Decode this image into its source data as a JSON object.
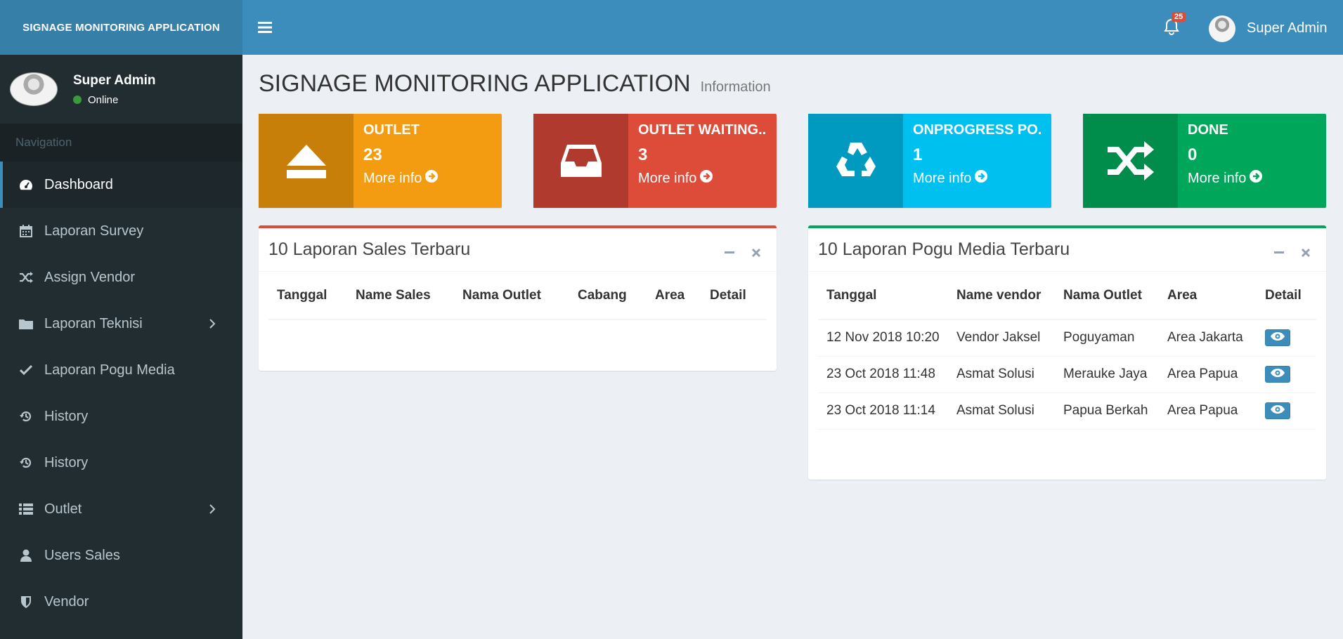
{
  "app": {
    "logo_text": "SIGNAGE MONITORING APPLICATION"
  },
  "sidebar": {
    "user_name": "Super Admin",
    "status": "Online",
    "nav_header": "Navigation",
    "items": [
      {
        "label": "Dashboard",
        "icon": "dashboard-icon",
        "active": true
      },
      {
        "label": "Laporan Survey",
        "icon": "calendar-icon"
      },
      {
        "label": "Assign Vendor",
        "icon": "shuffle-icon"
      },
      {
        "label": "Laporan Teknisi",
        "icon": "folder-icon",
        "has_children": true
      },
      {
        "label": "Laporan Pogu Media",
        "icon": "check-icon"
      },
      {
        "label": "History",
        "icon": "history-icon"
      },
      {
        "label": "History",
        "icon": "history-icon"
      },
      {
        "label": "Outlet",
        "icon": "list-icon",
        "has_children": true
      },
      {
        "label": "Users Sales",
        "icon": "user-icon"
      },
      {
        "label": "Vendor",
        "icon": "shield-icon"
      }
    ]
  },
  "header": {
    "notification_count": "25",
    "user_name": "Super Admin"
  },
  "page": {
    "title": "SIGNAGE MONITORING APPLICATION",
    "subtitle": "Information"
  },
  "info_boxes": [
    {
      "title": "OUTLET",
      "value": "23",
      "more": "More info",
      "icon": "eject-icon",
      "color": "#f39c12",
      "icon_bg": "#c87f0a"
    },
    {
      "title": "OUTLET WAITING...",
      "value": "3",
      "more": "More info",
      "icon": "inbox-icon",
      "color": "#dd4b39",
      "icon_bg": "#b03a2e"
    },
    {
      "title": "ONPROGRESS PO...",
      "value": "1",
      "more": "More info",
      "icon": "recycle-icon",
      "color": "#00c0ef",
      "icon_bg": "#009ac0"
    },
    {
      "title": "DONE",
      "value": "0",
      "more": "More info",
      "icon": "shuffle-icon",
      "color": "#00a65a",
      "icon_bg": "#008d4c"
    }
  ],
  "sales_box": {
    "title": "10 Laporan Sales Terbaru",
    "accent": "#dd4b39",
    "columns": [
      "Tanggal",
      "Name Sales",
      "Nama Outlet",
      "Cabang",
      "Area",
      "Detail"
    ]
  },
  "media_box": {
    "title": "10 Laporan Pogu Media Terbaru",
    "accent": "#00a65a",
    "columns": [
      "Tanggal",
      "Name vendor",
      "Nama Outlet",
      "Area",
      "Detail"
    ],
    "rows": [
      [
        "12 Nov 2018 10:20",
        "Vendor Jaksel",
        "Poguyaman",
        "Area Jakarta"
      ],
      [
        "23 Oct 2018 11:48",
        "Asmat Solusi",
        "Merauke Jaya",
        "Area Papua"
      ],
      [
        "23 Oct 2018 11:14",
        "Asmat Solusi",
        "Papua Berkah",
        "Area Papua"
      ]
    ]
  }
}
